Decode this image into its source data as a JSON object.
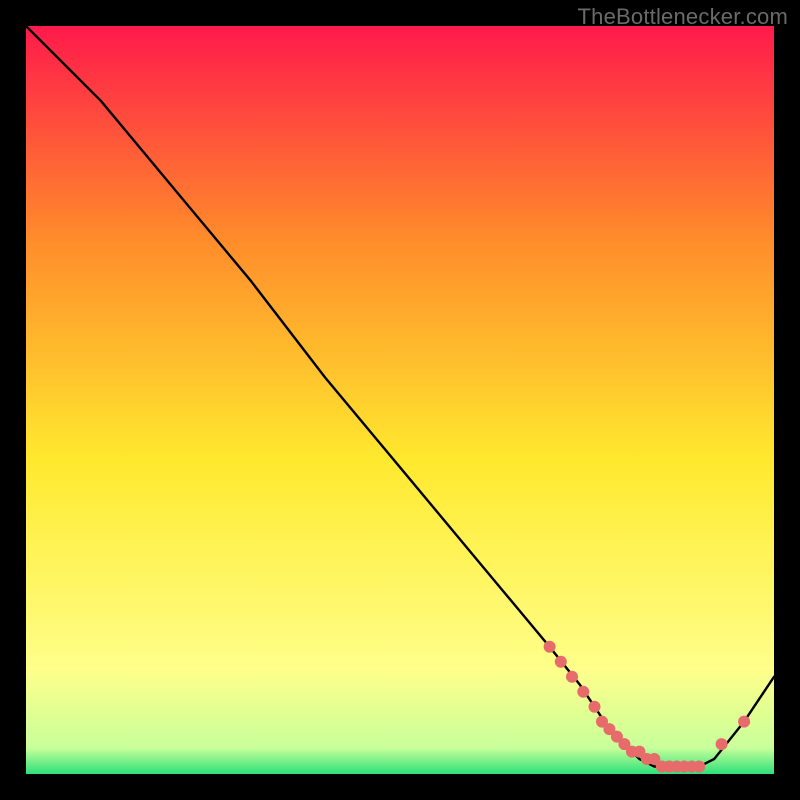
{
  "watermark": "TheBottlenecker.com",
  "chart_data": {
    "type": "line",
    "title": "",
    "xlabel": "",
    "ylabel": "",
    "xlim": [
      0,
      100
    ],
    "ylim": [
      0,
      100
    ],
    "background_gradient": {
      "top": "#ff1a4b",
      "upper_mid": "#ff8a2b",
      "mid": "#ffe92e",
      "lower_mid": "#ffff8a",
      "bottom": "#2de07a"
    },
    "series": [
      {
        "name": "curve",
        "color": "#000000",
        "x": [
          0,
          6,
          10,
          20,
          30,
          40,
          50,
          60,
          70,
          74,
          76,
          78,
          80,
          82,
          84,
          86,
          88,
          90,
          92,
          96,
          100
        ],
        "y": [
          100,
          94,
          90,
          78,
          66,
          53,
          41,
          29,
          17,
          12,
          9,
          6,
          4,
          2,
          1,
          1,
          1,
          1,
          2,
          7,
          13
        ]
      }
    ],
    "markers": {
      "name": "highlight-dots",
      "color": "#e86b6b",
      "x": [
        70,
        71.5,
        73,
        74.5,
        76,
        77,
        78,
        79,
        80,
        81,
        82,
        83,
        84,
        85,
        86,
        87,
        88,
        89,
        90,
        93,
        96
      ],
      "y": [
        17,
        15,
        13,
        11,
        9,
        7,
        6,
        5,
        4,
        3,
        3,
        2,
        2,
        1,
        1,
        1,
        1,
        1,
        1,
        4,
        7
      ]
    }
  }
}
